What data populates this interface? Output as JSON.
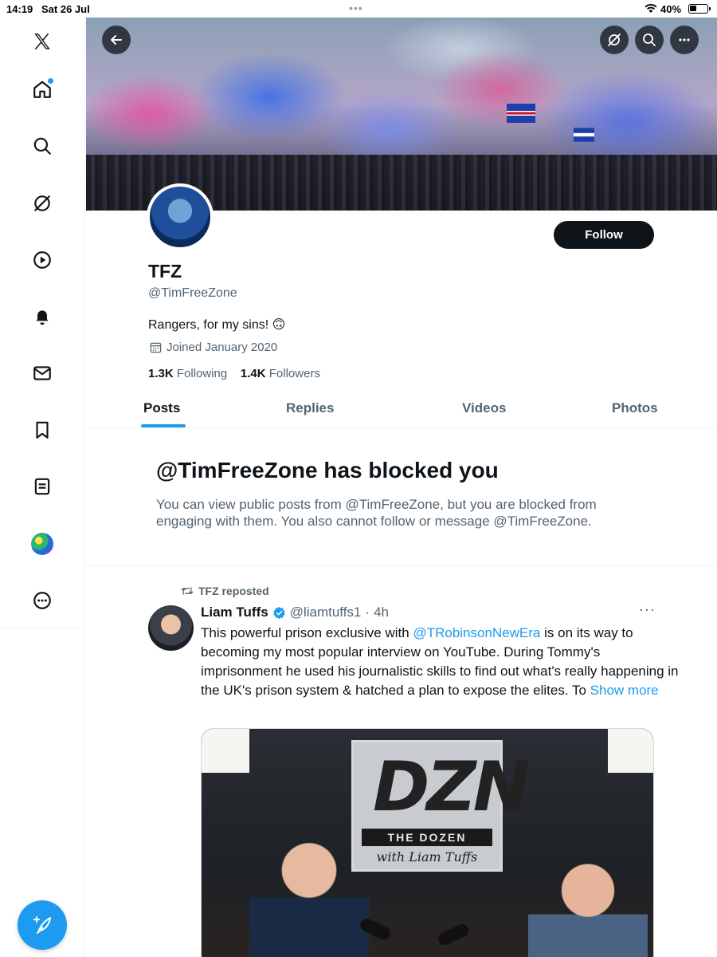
{
  "status_bar": {
    "time": "14:19",
    "date": "Sat 26 Jul",
    "battery": "40%"
  },
  "sidebar": {
    "items": [
      "x-logo",
      "home",
      "explore",
      "grok",
      "video",
      "notifications",
      "messages",
      "bookmarks",
      "lists",
      "communities",
      "more"
    ]
  },
  "profile": {
    "name": "TFZ",
    "handle": "@TimFreeZone",
    "bio": "Rangers, for my sins! 🙃",
    "joined": "Joined January 2020",
    "following_count": "1.3K",
    "following_label": "Following",
    "followers_count": "1.4K",
    "followers_label": "Followers",
    "follow_label": "Follow"
  },
  "tabs": [
    {
      "label": "Posts",
      "active": true
    },
    {
      "label": "Replies",
      "active": false
    },
    {
      "label": "Videos",
      "active": false
    },
    {
      "label": "Photos",
      "active": false
    }
  ],
  "blocked": {
    "title": "@TimFreeZone has blocked you",
    "text": "You can view public posts from @TimFreeZone, but you are blocked from engaging with them. You also cannot follow or message @TimFreeZone."
  },
  "tweet": {
    "repost_label": "TFZ reposted",
    "author_name": "Liam Tuffs",
    "author_handle": "@liamtuffs1",
    "sep": "·",
    "time": "4h",
    "more": "···",
    "body_1": "This powerful prison exclusive with ",
    "mention": "@TRobinsonNewEra",
    "body_2": " is on its way to becoming my most popular interview on YouTube. During Tommy's imprisonment he used his journalistic skills to find out what's really happening in the UK's prison system & hatched a plan to expose the elites. To ",
    "show_more": "Show more",
    "media": {
      "logo_text": "DZN",
      "logo_subtitle": "THE DOZEN",
      "logo_byline": "with Liam Tuffs"
    }
  },
  "colors": {
    "accent": "#1d9bf0",
    "text": "#0f1419",
    "muted": "#536471"
  }
}
